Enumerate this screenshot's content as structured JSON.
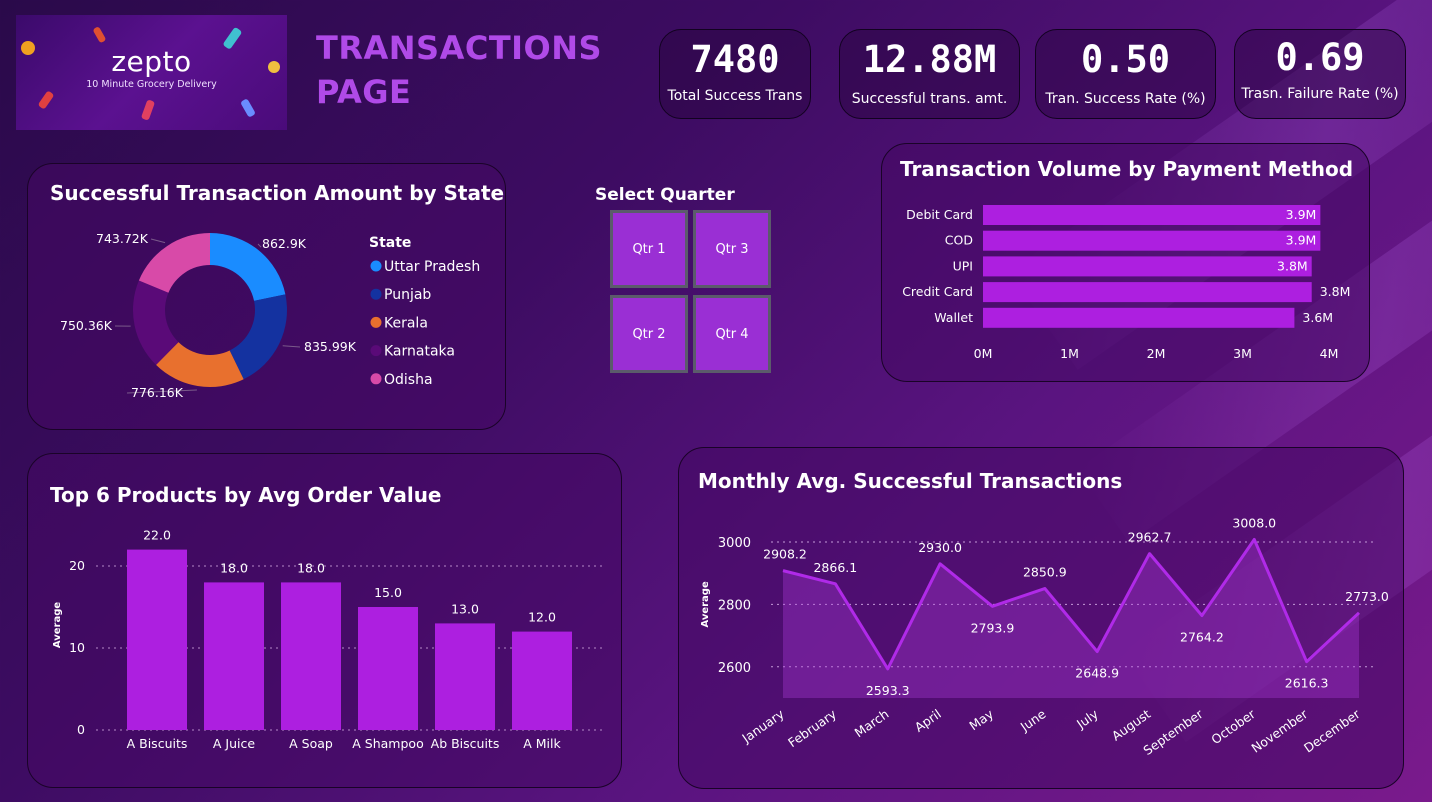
{
  "header": {
    "logo_name": "zepto",
    "logo_tagline": "10 Minute Grocery Delivery",
    "title_line1": "TRANSACTIONS",
    "title_line2": "PAGE"
  },
  "kpis": [
    {
      "value": "7480",
      "label": "Total Success Trans"
    },
    {
      "value": "12.88M",
      "label": "Successful trans. amt."
    },
    {
      "value": "0.50",
      "label": "Tran. Success Rate (%)"
    },
    {
      "value": "0.69",
      "label": "Trasn. Failure Rate (%)"
    }
  ],
  "slicer": {
    "title": "Select Quarter",
    "options": [
      "Qtr 1",
      "Qtr 3",
      "Qtr 2",
      "Qtr 4"
    ]
  },
  "colors": {
    "bar": "#ad1fe0",
    "accent_title": "#b04ae8",
    "donut": [
      "#1a8cff",
      "#1432a0",
      "#e8702e",
      "#5a0a78",
      "#d84aa8"
    ]
  },
  "chart_data": [
    {
      "type": "pie",
      "title": "Successful Transaction Amount by State",
      "legend_title": "State",
      "legend_position": "right",
      "categories": [
        "Uttar Pradesh",
        "Punjab",
        "Kerala",
        "Karnataka",
        "Odisha"
      ],
      "values": [
        862.9,
        835.99,
        776.16,
        750.36,
        743.72
      ],
      "labels": [
        "862.9K",
        "835.99K",
        "776.16K",
        "750.36K",
        "743.72K"
      ]
    },
    {
      "type": "bar",
      "orientation": "horizontal",
      "title": "Transaction Volume by Payment Method",
      "categories": [
        "Debit Card",
        "COD",
        "UPI",
        "Credit Card",
        "Wallet"
      ],
      "values": [
        3.9,
        3.9,
        3.8,
        3.8,
        3.6
      ],
      "labels": [
        "3.9M",
        "3.9M",
        "3.8M",
        "3.8M",
        "3.6M"
      ],
      "xlim": [
        0,
        4
      ],
      "xticks": [
        "0M",
        "1M",
        "2M",
        "3M",
        "4M"
      ]
    },
    {
      "type": "bar",
      "title": "Top 6 Products by Avg Order Value",
      "ylabel": "Average",
      "categories": [
        "A Biscuits",
        "A Juice",
        "A Soap",
        "A Shampoo",
        "Ab Biscuits",
        "A Milk"
      ],
      "values": [
        22.0,
        18.0,
        18.0,
        15.0,
        13.0,
        12.0
      ],
      "labels": [
        "22.0",
        "18.0",
        "18.0",
        "15.0",
        "13.0",
        "12.0"
      ],
      "ylim": [
        0,
        25
      ],
      "yticks": [
        "0",
        "10",
        "20"
      ],
      "grid": true
    },
    {
      "type": "area",
      "title": "Monthly Avg. Successful Transactions",
      "ylabel": "Average",
      "categories": [
        "January",
        "February",
        "March",
        "April",
        "May",
        "June",
        "July",
        "August",
        "September",
        "October",
        "November",
        "December"
      ],
      "values": [
        2908.2,
        2866.1,
        2593.3,
        2930.0,
        2793.9,
        2850.9,
        2648.9,
        2962.7,
        2764.2,
        3008.0,
        2616.3,
        2773.0
      ],
      "labels": [
        "2908.2",
        "2866.1",
        "2593.3",
        "2930.0",
        "2793.9",
        "2850.9",
        "2648.9",
        "2962.7",
        "2764.2",
        "3008.0",
        "2616.3",
        "2773.0"
      ],
      "ylim": [
        2500,
        3000
      ],
      "yticks": [
        "2600",
        "2800",
        "3000"
      ],
      "grid": true
    }
  ]
}
